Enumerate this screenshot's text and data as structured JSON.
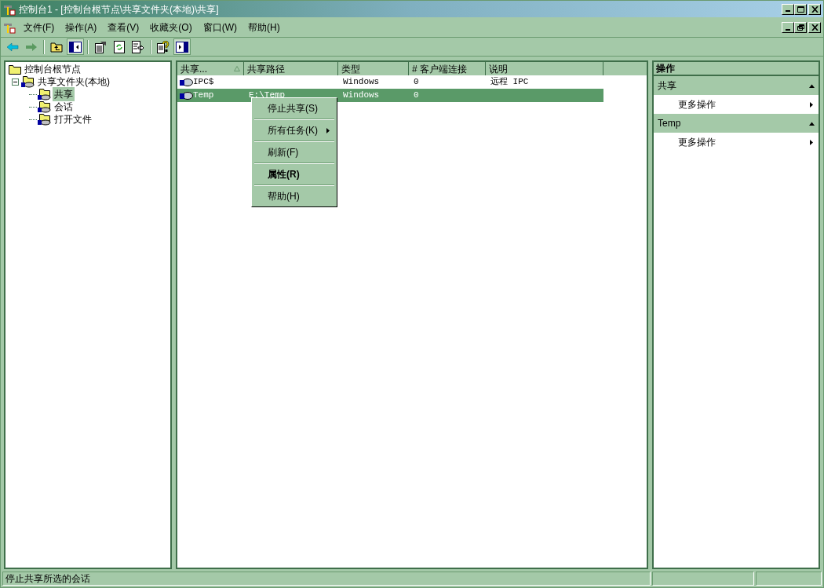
{
  "window": {
    "title": "控制台1 - [控制台根节点\\共享文件夹(本地)\\共享]"
  },
  "menu": [
    {
      "label": "文件(F)"
    },
    {
      "label": "操作(A)"
    },
    {
      "label": "查看(V)"
    },
    {
      "label": "收藏夹(O)"
    },
    {
      "label": "窗口(W)"
    },
    {
      "label": "帮助(H)"
    }
  ],
  "toolbar": [
    {
      "kind": "back",
      "pressed": false
    },
    {
      "kind": "forward",
      "pressed": false
    },
    {
      "kind": "sep"
    },
    {
      "kind": "up",
      "pressed": false
    },
    {
      "kind": "tree",
      "pressed": true
    },
    {
      "kind": "sep"
    },
    {
      "kind": "props",
      "pressed": false
    },
    {
      "kind": "refresh",
      "pressed": false
    },
    {
      "kind": "export",
      "pressed": false
    },
    {
      "kind": "sep"
    },
    {
      "kind": "help",
      "pressed": false
    },
    {
      "kind": "actionpane",
      "pressed": true
    }
  ],
  "tree": [
    {
      "label": "控制台根节点",
      "kind": "folder",
      "selected": false,
      "children": [
        {
          "label": "共享文件夹(本地)",
          "kind": "share",
          "selected": false,
          "expanded": true,
          "children": [
            {
              "label": "共享",
              "kind": "share",
              "selected": true
            },
            {
              "label": "会话",
              "kind": "share",
              "selected": false
            },
            {
              "label": "打开文件",
              "kind": "share",
              "selected": false
            }
          ]
        }
      ]
    }
  ],
  "list": {
    "columns": [
      {
        "label": "共享...",
        "sorted": true
      },
      {
        "label": "共享路径",
        "sorted": false
      },
      {
        "label": "类型",
        "sorted": false
      },
      {
        "label": "# 客户端连接",
        "sorted": false
      },
      {
        "label": "说明",
        "sorted": false
      }
    ],
    "rows": [
      {
        "cells": [
          "IPC$",
          "",
          "Windows",
          "0",
          "远程 IPC"
        ],
        "selected": false
      },
      {
        "cells": [
          "Temp",
          "E:\\Temp",
          "Windows",
          "0",
          ""
        ],
        "selected": true
      }
    ]
  },
  "context_menu": [
    {
      "label": "停止共享(S)",
      "bold": false,
      "submenu": false
    },
    {
      "label": "所有任务(K)",
      "bold": false,
      "submenu": true
    },
    {
      "label": "刷新(F)",
      "bold": false,
      "submenu": false
    },
    {
      "label": "属性(R)",
      "bold": true,
      "submenu": false
    },
    {
      "label": "帮助(H)",
      "bold": false,
      "submenu": false
    }
  ],
  "actions": {
    "title": "操作",
    "groups": [
      {
        "title": "共享",
        "expanded": true,
        "items": [
          "更多操作"
        ]
      },
      {
        "title": "Temp",
        "expanded": true,
        "items": [
          "更多操作"
        ]
      }
    ]
  },
  "status_bar": {
    "text": "停止共享所选的会话"
  }
}
